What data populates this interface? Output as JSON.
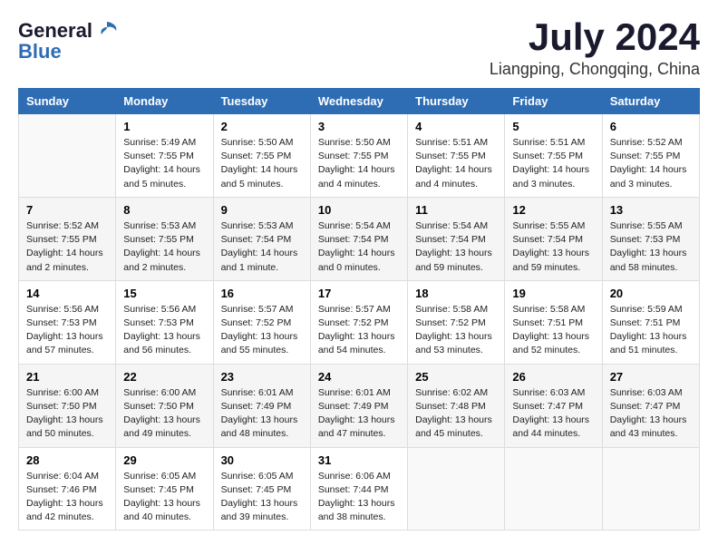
{
  "header": {
    "logo_line1": "General",
    "logo_line2": "Blue",
    "month": "July 2024",
    "location": "Liangping, Chongqing, China"
  },
  "weekdays": [
    "Sunday",
    "Monday",
    "Tuesday",
    "Wednesday",
    "Thursday",
    "Friday",
    "Saturday"
  ],
  "weeks": [
    [
      {
        "day": "",
        "content": ""
      },
      {
        "day": "1",
        "content": "Sunrise: 5:49 AM\nSunset: 7:55 PM\nDaylight: 14 hours\nand 5 minutes."
      },
      {
        "day": "2",
        "content": "Sunrise: 5:50 AM\nSunset: 7:55 PM\nDaylight: 14 hours\nand 5 minutes."
      },
      {
        "day": "3",
        "content": "Sunrise: 5:50 AM\nSunset: 7:55 PM\nDaylight: 14 hours\nand 4 minutes."
      },
      {
        "day": "4",
        "content": "Sunrise: 5:51 AM\nSunset: 7:55 PM\nDaylight: 14 hours\nand 4 minutes."
      },
      {
        "day": "5",
        "content": "Sunrise: 5:51 AM\nSunset: 7:55 PM\nDaylight: 14 hours\nand 3 minutes."
      },
      {
        "day": "6",
        "content": "Sunrise: 5:52 AM\nSunset: 7:55 PM\nDaylight: 14 hours\nand 3 minutes."
      }
    ],
    [
      {
        "day": "7",
        "content": "Sunrise: 5:52 AM\nSunset: 7:55 PM\nDaylight: 14 hours\nand 2 minutes."
      },
      {
        "day": "8",
        "content": "Sunrise: 5:53 AM\nSunset: 7:55 PM\nDaylight: 14 hours\nand 2 minutes."
      },
      {
        "day": "9",
        "content": "Sunrise: 5:53 AM\nSunset: 7:54 PM\nDaylight: 14 hours\nand 1 minute."
      },
      {
        "day": "10",
        "content": "Sunrise: 5:54 AM\nSunset: 7:54 PM\nDaylight: 14 hours\nand 0 minutes."
      },
      {
        "day": "11",
        "content": "Sunrise: 5:54 AM\nSunset: 7:54 PM\nDaylight: 13 hours\nand 59 minutes."
      },
      {
        "day": "12",
        "content": "Sunrise: 5:55 AM\nSunset: 7:54 PM\nDaylight: 13 hours\nand 59 minutes."
      },
      {
        "day": "13",
        "content": "Sunrise: 5:55 AM\nSunset: 7:53 PM\nDaylight: 13 hours\nand 58 minutes."
      }
    ],
    [
      {
        "day": "14",
        "content": "Sunrise: 5:56 AM\nSunset: 7:53 PM\nDaylight: 13 hours\nand 57 minutes."
      },
      {
        "day": "15",
        "content": "Sunrise: 5:56 AM\nSunset: 7:53 PM\nDaylight: 13 hours\nand 56 minutes."
      },
      {
        "day": "16",
        "content": "Sunrise: 5:57 AM\nSunset: 7:52 PM\nDaylight: 13 hours\nand 55 minutes."
      },
      {
        "day": "17",
        "content": "Sunrise: 5:57 AM\nSunset: 7:52 PM\nDaylight: 13 hours\nand 54 minutes."
      },
      {
        "day": "18",
        "content": "Sunrise: 5:58 AM\nSunset: 7:52 PM\nDaylight: 13 hours\nand 53 minutes."
      },
      {
        "day": "19",
        "content": "Sunrise: 5:58 AM\nSunset: 7:51 PM\nDaylight: 13 hours\nand 52 minutes."
      },
      {
        "day": "20",
        "content": "Sunrise: 5:59 AM\nSunset: 7:51 PM\nDaylight: 13 hours\nand 51 minutes."
      }
    ],
    [
      {
        "day": "21",
        "content": "Sunrise: 6:00 AM\nSunset: 7:50 PM\nDaylight: 13 hours\nand 50 minutes."
      },
      {
        "day": "22",
        "content": "Sunrise: 6:00 AM\nSunset: 7:50 PM\nDaylight: 13 hours\nand 49 minutes."
      },
      {
        "day": "23",
        "content": "Sunrise: 6:01 AM\nSunset: 7:49 PM\nDaylight: 13 hours\nand 48 minutes."
      },
      {
        "day": "24",
        "content": "Sunrise: 6:01 AM\nSunset: 7:49 PM\nDaylight: 13 hours\nand 47 minutes."
      },
      {
        "day": "25",
        "content": "Sunrise: 6:02 AM\nSunset: 7:48 PM\nDaylight: 13 hours\nand 45 minutes."
      },
      {
        "day": "26",
        "content": "Sunrise: 6:03 AM\nSunset: 7:47 PM\nDaylight: 13 hours\nand 44 minutes."
      },
      {
        "day": "27",
        "content": "Sunrise: 6:03 AM\nSunset: 7:47 PM\nDaylight: 13 hours\nand 43 minutes."
      }
    ],
    [
      {
        "day": "28",
        "content": "Sunrise: 6:04 AM\nSunset: 7:46 PM\nDaylight: 13 hours\nand 42 minutes."
      },
      {
        "day": "29",
        "content": "Sunrise: 6:05 AM\nSunset: 7:45 PM\nDaylight: 13 hours\nand 40 minutes."
      },
      {
        "day": "30",
        "content": "Sunrise: 6:05 AM\nSunset: 7:45 PM\nDaylight: 13 hours\nand 39 minutes."
      },
      {
        "day": "31",
        "content": "Sunrise: 6:06 AM\nSunset: 7:44 PM\nDaylight: 13 hours\nand 38 minutes."
      },
      {
        "day": "",
        "content": ""
      },
      {
        "day": "",
        "content": ""
      },
      {
        "day": "",
        "content": ""
      }
    ]
  ]
}
